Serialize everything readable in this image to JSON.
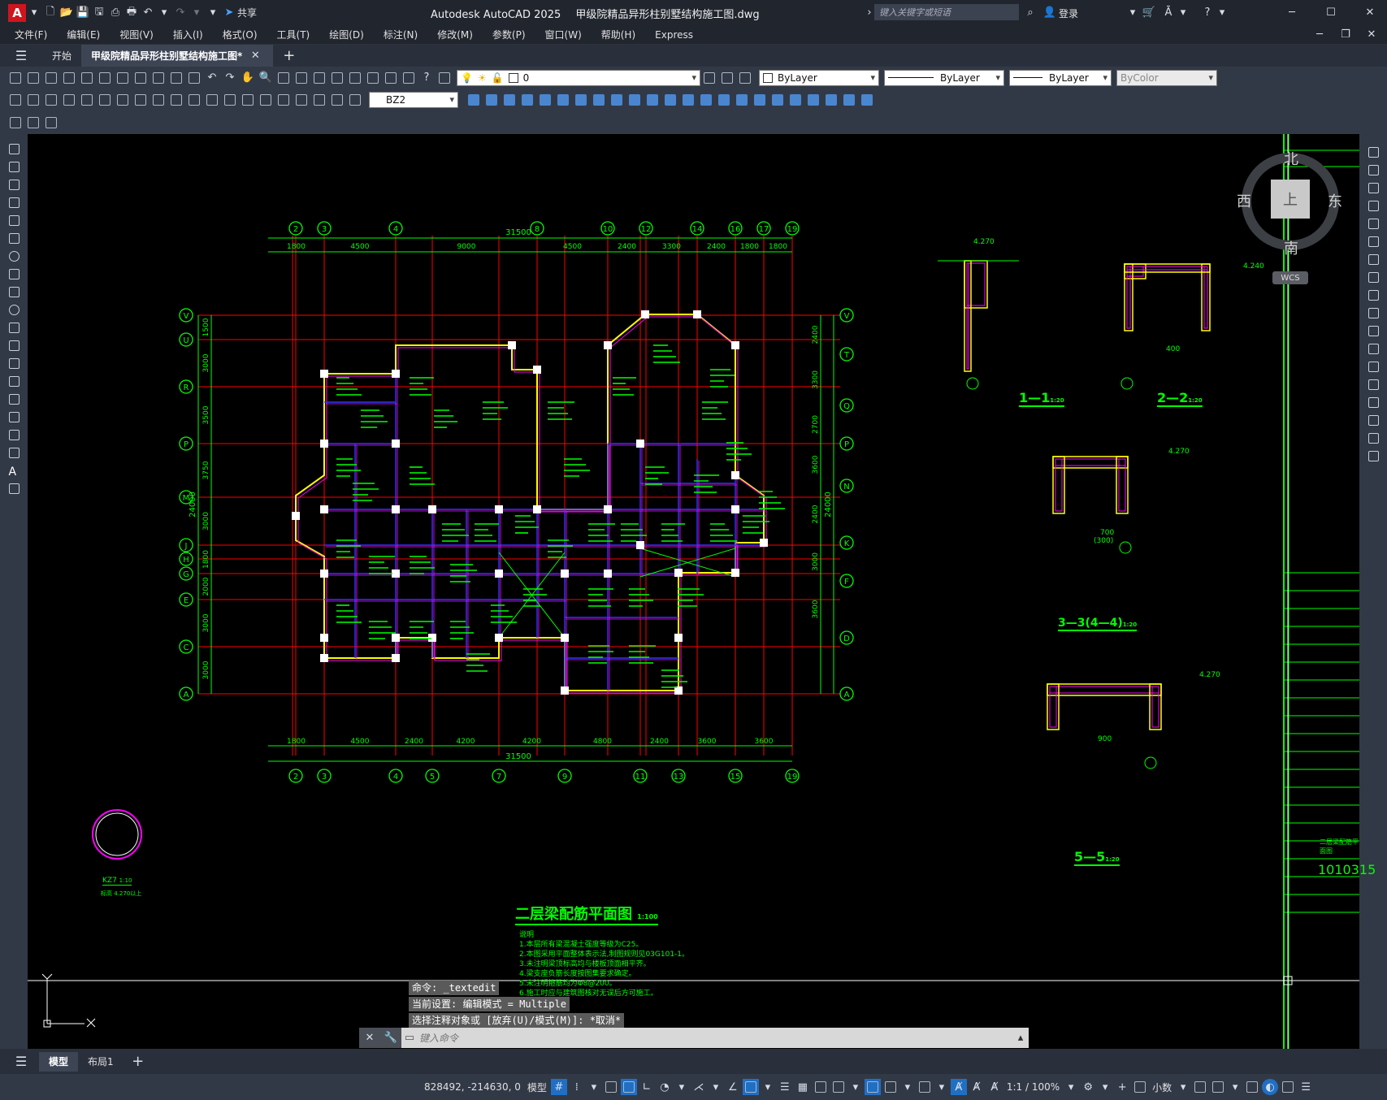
{
  "window": {
    "app_title": "Autodesk AutoCAD 2025",
    "file_title": "甲级院精品异形柱别墅结构施工图.dwg",
    "share_label": "共享",
    "search_placeholder": "键入关键字或短语",
    "login_label": "登录"
  },
  "menu": [
    "文件(F)",
    "编辑(E)",
    "视图(V)",
    "插入(I)",
    "格式(O)",
    "工具(T)",
    "绘图(D)",
    "标注(N)",
    "修改(M)",
    "参数(P)",
    "窗口(W)",
    "帮助(H)",
    "Express"
  ],
  "tabs": {
    "start": "开始",
    "doc": "甲级院精品异形柱别墅结构施工图*",
    "add": "+"
  },
  "layer": {
    "name": "0",
    "color": "ByLayer",
    "linetype": "ByLayer",
    "lineweight": "ByLayer",
    "plotstyle": "ByColor"
  },
  "dimstyle": "BZ2",
  "viewcube": {
    "north": "北",
    "south": "南",
    "east": "东",
    "west": "西",
    "top": "上",
    "wcs": "WCS"
  },
  "drawing": {
    "main_title": "二层梁配筋平面图",
    "main_scale": "1:100",
    "axis_top": [
      "2",
      "3",
      "4",
      "8",
      "10",
      "12",
      "14",
      "16",
      "17",
      "19"
    ],
    "axis_bottom": [
      "2",
      "3",
      "4",
      "5",
      "7",
      "9",
      "11",
      "13",
      "15",
      "19"
    ],
    "axis_left": [
      "V",
      "U",
      "R",
      "P",
      "M",
      "J",
      "H",
      "G",
      "E",
      "C",
      "A"
    ],
    "axis_right": [
      "V",
      "T",
      "Q",
      "P",
      "N",
      "K",
      "F",
      "D",
      "A"
    ],
    "dims_top": [
      "1800",
      "4500",
      "9000",
      "4500",
      "2400",
      "3300",
      "2400",
      "1800",
      "1800"
    ],
    "dim_top_total": "31500",
    "dims_bottom": [
      "1800",
      "4500",
      "2400",
      "4200",
      "4200",
      "4800",
      "2400",
      "3600",
      "3600"
    ],
    "dim_bottom_total": "31500",
    "dims_left": [
      "1500",
      "3000",
      "3500",
      "3750",
      "3000",
      "1800",
      "2000",
      "3000",
      "3000"
    ],
    "dim_left_total": "24000",
    "dims_right": [
      "2400",
      "3300",
      "2700",
      "3600",
      "2400",
      "3000",
      "3600"
    ],
    "dim_right_total": "24000",
    "sections": [
      {
        "name": "1—1",
        "scale": "1:20"
      },
      {
        "name": "2—2",
        "scale": "1:20"
      },
      {
        "name": "3—3(4—4)",
        "scale": "1:20"
      },
      {
        "name": "5—5",
        "scale": "1:20"
      }
    ],
    "section_notes": {
      "s1_elev": "4.270",
      "s2_elev": "4.240",
      "s3_elev": "4.270",
      "s5_elev": "4.270",
      "s3_dims": [
        "700",
        "(300)"
      ],
      "s5_dim": "900",
      "s2_dim": "400"
    },
    "kz_label": "KZ7",
    "kz_scale": "1:10",
    "kz_elev": "标高 4.270以上",
    "notes_title": "说明",
    "notes": [
      "1.本层所有梁混凝土强度等级为C25。",
      "2.本图采用平面整体表示法,制图规则见03G101-1。",
      "3.未注明梁顶标高均与楼板顶面相平齐。",
      "4.梁支座负筋长度按图集要求确定。",
      "5.未注明箍筋均为Φ8@200。",
      "6.施工时应与建筑图核对无误后方可施工。"
    ],
    "titleblock": {
      "drawing_no": "1010315",
      "title_short": "二层梁配筋平面图"
    }
  },
  "command": {
    "history": [
      "命令: _textedit",
      "当前设置: 编辑模式 = Multiple",
      "选择注释对象或 [放弃(U)/模式(M)]: *取消*"
    ],
    "input_placeholder": "键入命令"
  },
  "layout_tabs": [
    "模型",
    "布局1"
  ],
  "status": {
    "coords": "828492, -214630, 0",
    "model": "模型",
    "scale": "1:1 / 100%",
    "units": "小数"
  },
  "colors": {
    "green": "#00ff00",
    "red": "#ff0000",
    "yellow": "#ffff00",
    "magenta": "#ff00ff",
    "blue": "#3333ff",
    "white": "#ffffff",
    "accent": "#0078d4"
  }
}
